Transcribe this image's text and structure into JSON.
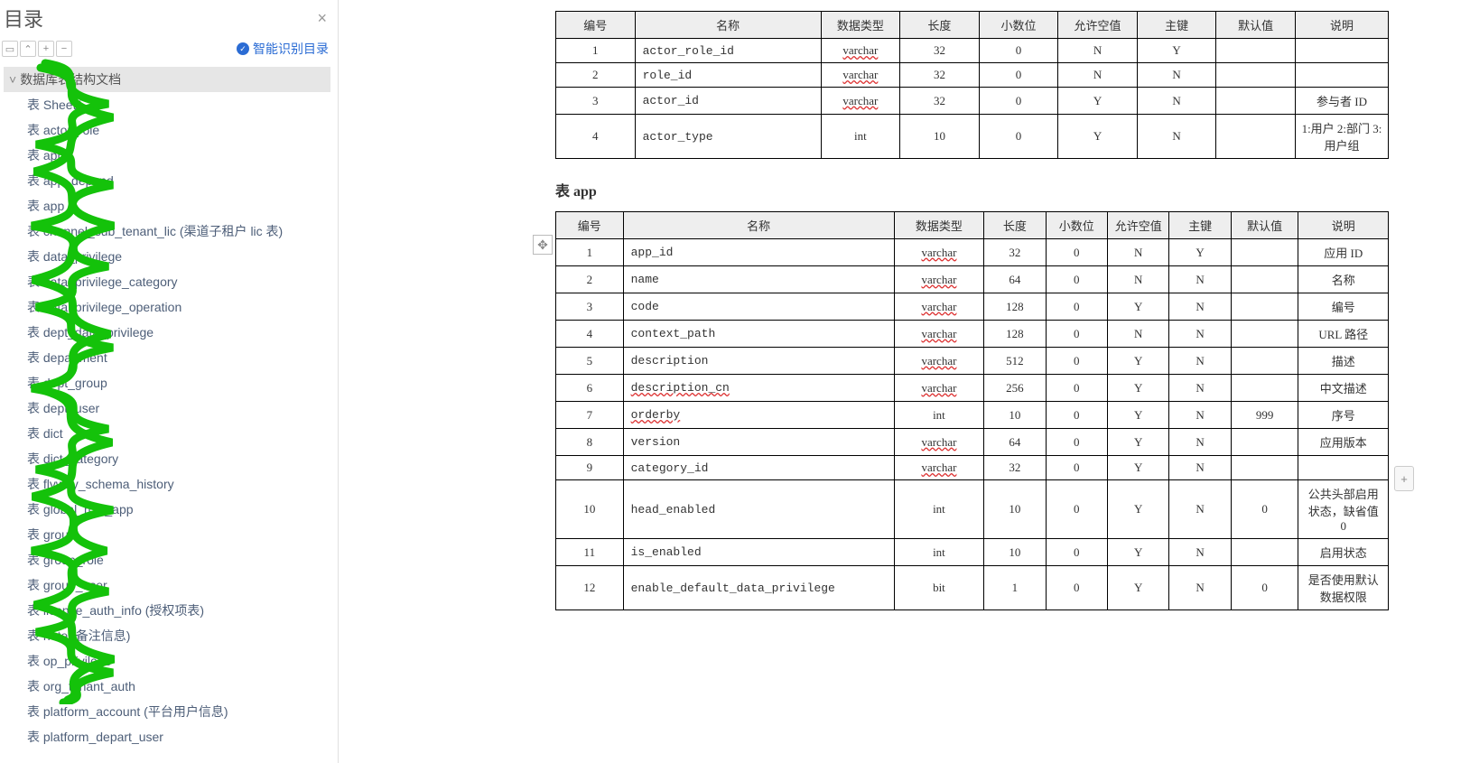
{
  "sidebar": {
    "title": "目录",
    "smart_link": "智能识别目录",
    "root": "数据库表结构文档",
    "items": [
      "表 Sheet1",
      "表 actor_role",
      "表 app",
      "表 app_depend",
      "表 app",
      "表 channel_sub_tenant_lic (渠道子租户 lic 表)",
      "表 data_privilege",
      "表 data_privilege_category",
      "表 data_privilege_operation",
      "表 dept_data_privilege",
      "表 department",
      "表 dept_group",
      "表 dept_user",
      "表 dict",
      "表 dict_category",
      "表 flyway_schema_history",
      "表 global_role_app",
      "表 group",
      "表 group_role",
      "表 group_user",
      "表 license_auth_info (授权项表)",
      "表 note (备注信息)",
      "表 op_privilege",
      "表 org_tenant_auth",
      "表 platform_account (平台用户信息)",
      "表 platform_depart_user"
    ]
  },
  "table1": {
    "headers": [
      "编号",
      "名称",
      "数据类型",
      "长度",
      "小数位",
      "允许空值",
      "主键",
      "默认值",
      "说明"
    ],
    "rows": [
      {
        "no": "1",
        "name": "actor_role_id",
        "type": "varchar",
        "len": "32",
        "dec": "0",
        "null": "N",
        "pk": "Y",
        "def": "",
        "desc": ""
      },
      {
        "no": "2",
        "name": "role_id",
        "type": "varchar",
        "len": "32",
        "dec": "0",
        "null": "N",
        "pk": "N",
        "def": "",
        "desc": ""
      },
      {
        "no": "3",
        "name": "actor_id",
        "type": "varchar",
        "len": "32",
        "dec": "0",
        "null": "Y",
        "pk": "N",
        "def": "",
        "desc": "参与者 ID"
      },
      {
        "no": "4",
        "name": "actor_type",
        "type": "int",
        "len": "10",
        "dec": "0",
        "null": "Y",
        "pk": "N",
        "def": "",
        "desc": "1:用户 2:部门 3:用户组"
      }
    ]
  },
  "table2": {
    "title": "表 app",
    "headers": [
      "编号",
      "名称",
      "数据类型",
      "长度",
      "小数位",
      "允许空值",
      "主键",
      "默认值",
      "说明"
    ],
    "rows": [
      {
        "no": "1",
        "name": "app_id",
        "type": "varchar",
        "len": "32",
        "dec": "0",
        "null": "N",
        "pk": "Y",
        "def": "",
        "desc": "应用 ID"
      },
      {
        "no": "2",
        "name": "name",
        "type": "varchar",
        "len": "64",
        "dec": "0",
        "null": "N",
        "pk": "N",
        "def": "",
        "desc": "名称"
      },
      {
        "no": "3",
        "name": "code",
        "type": "varchar",
        "len": "128",
        "dec": "0",
        "null": "Y",
        "pk": "N",
        "def": "",
        "desc": "编号"
      },
      {
        "no": "4",
        "name": "context_path",
        "type": "varchar",
        "len": "128",
        "dec": "0",
        "null": "N",
        "pk": "N",
        "def": "",
        "desc": "URL 路径"
      },
      {
        "no": "5",
        "name": "description",
        "type": "varchar",
        "len": "512",
        "dec": "0",
        "null": "Y",
        "pk": "N",
        "def": "",
        "desc": "描述"
      },
      {
        "no": "6",
        "name": "description_cn",
        "type": "varchar",
        "len": "256",
        "dec": "0",
        "null": "Y",
        "pk": "N",
        "def": "",
        "desc": "中文描述"
      },
      {
        "no": "7",
        "name": "orderby",
        "type": "int",
        "len": "10",
        "dec": "0",
        "null": "Y",
        "pk": "N",
        "def": "999",
        "desc": "序号"
      },
      {
        "no": "8",
        "name": "version",
        "type": "varchar",
        "len": "64",
        "dec": "0",
        "null": "Y",
        "pk": "N",
        "def": "",
        "desc": "应用版本"
      },
      {
        "no": "9",
        "name": "category_id",
        "type": "varchar",
        "len": "32",
        "dec": "0",
        "null": "Y",
        "pk": "N",
        "def": "",
        "desc": ""
      },
      {
        "no": "10",
        "name": "head_enabled",
        "type": "int",
        "len": "10",
        "dec": "0",
        "null": "Y",
        "pk": "N",
        "def": "0",
        "desc": "公共头部启用状态，缺省值 0"
      },
      {
        "no": "11",
        "name": "is_enabled",
        "type": "int",
        "len": "10",
        "dec": "0",
        "null": "Y",
        "pk": "N",
        "def": "",
        "desc": "启用状态"
      },
      {
        "no": "12",
        "name": "enable_default_data_privilege",
        "type": "bit",
        "len": "1",
        "dec": "0",
        "null": "Y",
        "pk": "N",
        "def": "0",
        "desc": "是否使用默认数据权限"
      }
    ]
  },
  "underline_types": [
    "varchar",
    "orderby",
    "description_cn"
  ]
}
